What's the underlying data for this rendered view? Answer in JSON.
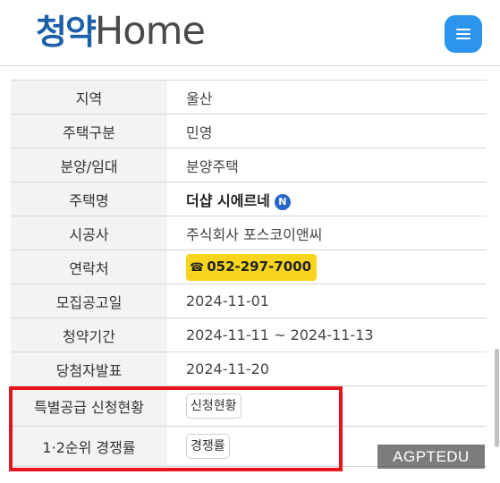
{
  "header": {
    "logo_ko": "청약",
    "logo_en": "Home",
    "menu_icon": "hamburger-icon"
  },
  "table": {
    "rows": [
      {
        "label": "지역",
        "value": "울산"
      },
      {
        "label": "주택구분",
        "value": "민영"
      },
      {
        "label": "분양/임대",
        "value": "분양주택"
      },
      {
        "label": "주택명",
        "value": "더샵 시에르네",
        "badge": "N"
      },
      {
        "label": "시공사",
        "value": "주식회사 포스코이앤씨"
      },
      {
        "label": "연락처",
        "value": "052-297-7000",
        "icon": "phone-icon"
      },
      {
        "label": "모집공고일",
        "value": "2024-11-01"
      },
      {
        "label": "청약기간",
        "value": "2024-11-11 ~ 2024-11-13"
      },
      {
        "label": "당첨자발표",
        "value": "2024-11-20"
      },
      {
        "label": "특별공급 신청현황",
        "button": "신청현황"
      },
      {
        "label": "1·2순위 경쟁률",
        "button": "경쟁률"
      }
    ]
  },
  "colors": {
    "highlight": "#e8141c",
    "brand_blue": "#1d5fa8",
    "menu_button": "#2b95ee",
    "phone_pill": "#f7d51c"
  },
  "watermark": "AGPTEDU"
}
